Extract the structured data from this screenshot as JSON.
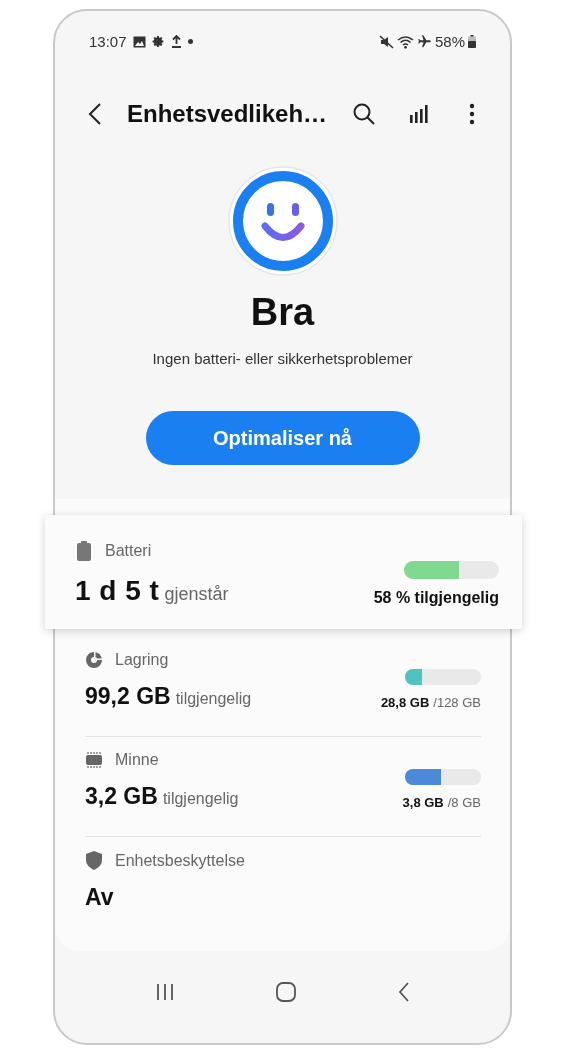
{
  "status_bar": {
    "time": "13:07",
    "battery": "58%"
  },
  "app_bar": {
    "title": "Enhetsvedlikeh…"
  },
  "status": {
    "title": "Bra",
    "subtitle": "Ingen batteri- eller sikkerhetsproblemer"
  },
  "optimize_button": "Optimaliser nå",
  "items": [
    {
      "kind": "battery",
      "label": "Batteri",
      "value": "1 d 5 t",
      "unit": "gjenstår",
      "level": 0.58,
      "color": "#7fd98f",
      "reading": "58 % tilgjengelig",
      "highlighted": true
    },
    {
      "kind": "storage",
      "label": "Lagring",
      "value": "99,2 GB",
      "unit": "tilgjengelig",
      "level": 0.225,
      "color": "#4fc3c2",
      "used": "28,8 GB",
      "total": "/128 GB",
      "highlighted": false
    },
    {
      "kind": "memory",
      "label": "Minne",
      "value": "3,2 GB",
      "unit": "tilgjengelig",
      "level": 0.475,
      "color": "#4a8ad6",
      "used": "3,8 GB",
      "total": "/8 GB",
      "highlighted": false
    },
    {
      "kind": "protection",
      "label": "Enhetsbeskyttelse",
      "value": "Av",
      "highlighted": false
    }
  ]
}
